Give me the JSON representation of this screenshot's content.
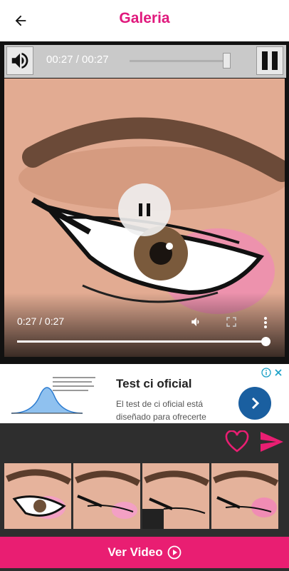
{
  "header": {
    "title": "Galeria"
  },
  "player": {
    "top_time": "00:27 / 00:27",
    "bottom_time": "0:27 / 0:27",
    "progress": 1.0,
    "seek_progress": 0.95
  },
  "ad": {
    "title": "Test ci oficial",
    "description": "El test de ci oficial está diseñado para ofrecerte una evaluación..."
  },
  "cta": {
    "label": "Ver Video"
  },
  "colors": {
    "brand": "#e0197d",
    "cta": "#e91e72",
    "ad_button": "#1a5fa0"
  }
}
